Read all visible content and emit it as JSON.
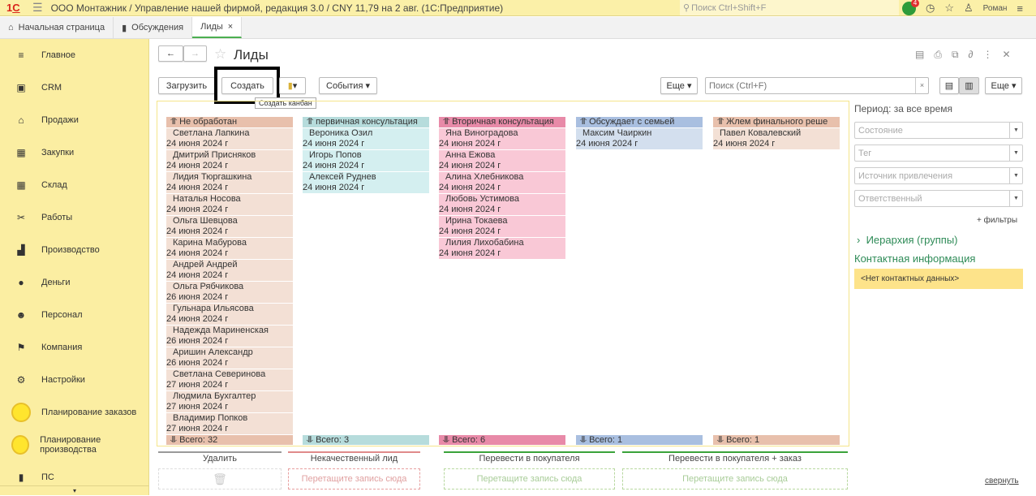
{
  "app": {
    "title": "ООО Монтажник / Управление нашей фирмой, редакция 3.0 / CNY 11,79 на 2 авг.  (1С:Предприятие)",
    "search_placeholder": "Поиск Ctrl+Shift+F",
    "notifications": "4",
    "user": "Роман",
    "logo": "1С"
  },
  "tabs": [
    {
      "label": "Начальная страница",
      "icon": "home-icon"
    },
    {
      "label": "Обсуждения",
      "icon": "chat-icon"
    },
    {
      "label": "Лиды",
      "active": true
    }
  ],
  "sidebar": {
    "items": [
      {
        "label": "Главное",
        "icon": "≡"
      },
      {
        "label": "CRM",
        "icon": "▣"
      },
      {
        "label": "Продажи",
        "icon": "⌂"
      },
      {
        "label": "Закупки",
        "icon": "▦"
      },
      {
        "label": "Склад",
        "icon": "▦"
      },
      {
        "label": "Работы",
        "icon": "✂"
      },
      {
        "label": "Производство",
        "icon": "▟"
      },
      {
        "label": "Деньги",
        "icon": "●"
      },
      {
        "label": "Персонал",
        "icon": "☻"
      },
      {
        "label": "Компания",
        "icon": "⚑"
      },
      {
        "label": "Настройки",
        "icon": "⚙"
      },
      {
        "label": "Планирование заказов",
        "icon": "circle"
      },
      {
        "label": "Планирование производства",
        "icon": "circle"
      },
      {
        "label": "ПС",
        "icon": "▮"
      }
    ]
  },
  "page": {
    "title": "Лиды"
  },
  "toolbar": {
    "load": "Загрузить",
    "create": "Создать",
    "events": "События",
    "more": "Еще",
    "search_placeholder": "Поиск (Ctrl+F)",
    "more2": "Еще",
    "tooltip": "Создать канбан"
  },
  "board": {
    "columns": [
      {
        "title": "Не обработан",
        "color": "#e8c0ac",
        "card_color": "#f3e0d5",
        "total": "Всего: 32",
        "cards": [
          [
            "Светлана Лапкина",
            "24 июня 2024 г"
          ],
          [
            "Дмитрий Присняков",
            "24 июня 2024 г"
          ],
          [
            "Лидия Тюргашкина",
            "24 июня 2024 г"
          ],
          [
            "Наталья Носова",
            "24 июня 2024 г"
          ],
          [
            "Ольга Шевцова",
            "24 июня 2024 г"
          ],
          [
            "Карина Мабурова",
            "24 июня 2024 г"
          ],
          [
            "Андрей Андрей",
            "24 июня 2024 г"
          ],
          [
            "Ольга Рябчикова",
            "26 июня 2024 г"
          ],
          [
            "Гульнара Ильясова",
            "24 июня 2024 г"
          ],
          [
            "Надежда Мариненская",
            "26 июня 2024 г"
          ],
          [
            "Аришин Александр",
            "26 июня 2024 г"
          ],
          [
            "Светлана Северинова",
            "27 июня 2024 г"
          ],
          [
            "Людмила Бухгалтер",
            "27 июня 2024 г"
          ],
          [
            "Владимир Попков",
            "27 июня 2024 г"
          ]
        ]
      },
      {
        "title": "первичная консультация",
        "color": "#b6dcdc",
        "card_color": "#d4eff0",
        "total": "Всего: 3",
        "cards": [
          [
            "Вероника Озил",
            "24 июня 2024 г"
          ],
          [
            "Игорь Попов",
            "24 июня 2024 г"
          ],
          [
            "Алексей Руднев",
            "24 июня 2024 г"
          ]
        ]
      },
      {
        "title": "Вторичная консультация",
        "color": "#e88aa8",
        "card_color": "#f9c8d6",
        "total": "Всего: 6",
        "cards": [
          [
            "Яна Виноградова",
            "24 июня 2024 г"
          ],
          [
            "Анна Ежова",
            "24 июня 2024 г"
          ],
          [
            "Алина Хлебникова",
            "24 июня 2024 г"
          ],
          [
            "Любовь Устимова",
            "24 июня 2024 г"
          ],
          [
            "Ирина Токаева",
            "24 июня 2024 г"
          ],
          [
            "Лилия Лихобабина",
            "24 июня 2024 г"
          ]
        ]
      },
      {
        "title": "Обсуждает с семьей",
        "color": "#a9bfe0",
        "card_color": "#d3dfee",
        "total": "Всего: 1",
        "cards": [
          [
            "Максим Чаиркин",
            "24 июня 2024 г"
          ]
        ]
      },
      {
        "title": "Жлем финального реше",
        "color": "#e8c0ac",
        "card_color": "#f3e0d5",
        "total": "Всего: 1",
        "cards": [
          [
            "Павел Ковалевский",
            "24 июня 2024 г"
          ]
        ]
      }
    ]
  },
  "dropzones": [
    {
      "label": "Удалить",
      "color": "#999999",
      "hint": "",
      "icon": "trash-icon"
    },
    {
      "label": "Некачественный лид",
      "color": "#e08a8a",
      "hint": "Перетащите запись сюда"
    },
    {
      "label": "Перевести в покупателя",
      "color": "#3aa33a",
      "hint": "Перетащите запись сюда"
    },
    {
      "label": "Перевести в покупателя + заказ",
      "color": "#3aa33a",
      "hint": "Перетащите запись сюда"
    }
  ],
  "filters": {
    "period": "Период: за все время",
    "fields": [
      "Состояние",
      "Тег",
      "Источник привлечения",
      "Ответственный"
    ],
    "more": "+ фильтры",
    "hierarchy": "Иерархия (группы)",
    "contact_title": "Контактная информация",
    "contact_value": "<Нет контактных данных>",
    "collapse": "свернуть"
  }
}
